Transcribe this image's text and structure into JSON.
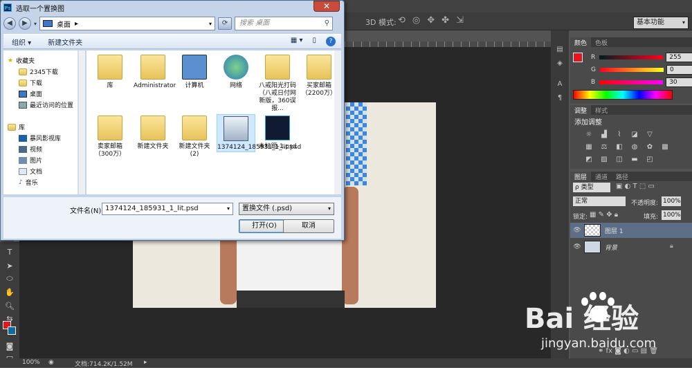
{
  "dialog": {
    "title": "选取一个置换图",
    "close": "✕",
    "address": "桌面",
    "address_arrow": "▸",
    "search_placeholder": "搜索 桌面",
    "toolbar": {
      "organize": "组织 ▾",
      "new_folder": "新建文件夹"
    },
    "nav": [
      {
        "label": "收藏夹"
      },
      {
        "label": "2345下载"
      },
      {
        "label": "下载"
      },
      {
        "label": "桌面"
      },
      {
        "label": "最近访问的位置"
      },
      {
        "label": "库"
      },
      {
        "label": "暴风影视库"
      },
      {
        "label": "视频"
      },
      {
        "label": "图片"
      },
      {
        "label": "文档"
      },
      {
        "label": "音乐"
      }
    ],
    "files": [
      {
        "label": "库"
      },
      {
        "label": "Administrator"
      },
      {
        "label": "计算机"
      },
      {
        "label": "网络"
      },
      {
        "label": "八戒阳光打码（八戒日付网新版，360误报..."
      },
      {
        "label": "买家邮箱（2200万）"
      },
      {
        "label": "卖家邮箱（300万）"
      },
      {
        "label": "新建文件夹"
      },
      {
        "label": "新建文件夹(2)"
      },
      {
        "label": "1374124_185931_1_lit.psd"
      },
      {
        "label": "未标题-1.psd"
      }
    ],
    "filename_label": "文件名(N):",
    "filename_value": "1374124_185931_1_lit.psd",
    "filetype_value": "置换文件 (.psd)",
    "open_button": "打开(O)",
    "cancel_button": "取消"
  },
  "ps": {
    "mode_3d": "3D 模式:",
    "workspace": "基本功能",
    "status_zoom": "100%",
    "status_doc": "文档:714.2K/1.52M",
    "color_panel": {
      "tabs": [
        "颜色",
        "色板"
      ],
      "r_label": "R",
      "r_value": "255",
      "g_label": "G",
      "g_value": "0",
      "b_label": "B",
      "b_value": "30"
    },
    "adjust_panel": {
      "tabs": [
        "调整",
        "样式"
      ],
      "title": "添加调整"
    },
    "layers_panel": {
      "tabs": [
        "图层",
        "通道",
        "路径"
      ],
      "kind": "ρ 类型",
      "blend": "正常",
      "opacity_label": "不透明度:",
      "opacity_value": "100%",
      "lock_label": "锁定:",
      "fill_label": "填充:",
      "fill_value": "100%",
      "layers": [
        {
          "name": "图层 1"
        },
        {
          "name": "背景"
        }
      ]
    }
  },
  "watermark": {
    "logo": "Bai  经验",
    "url": "jingyan.baidu.com"
  },
  "colors": {
    "foreground": "#e8141b",
    "background": "#116aa4",
    "accent": "#3aa0e0"
  }
}
